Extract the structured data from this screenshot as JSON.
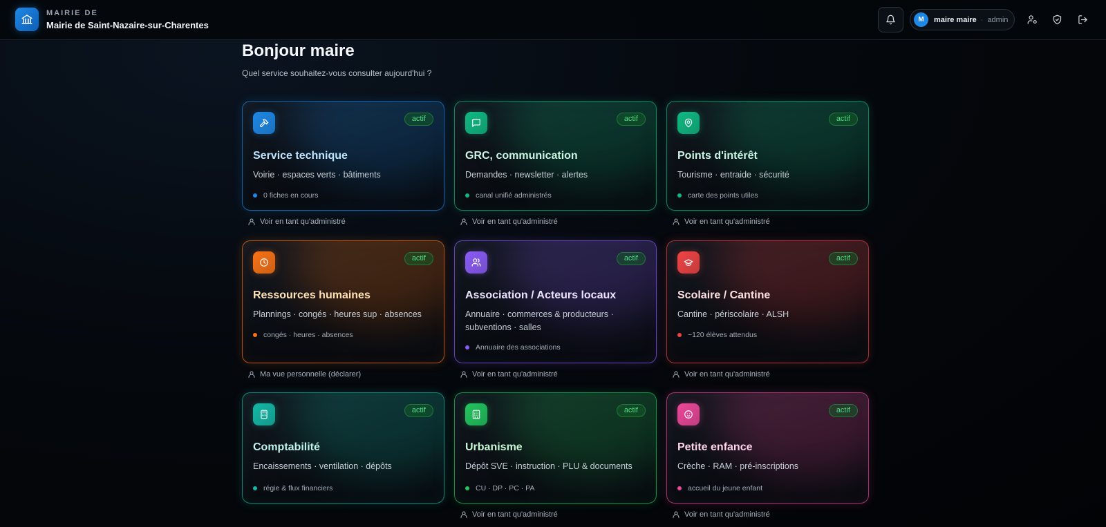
{
  "header": {
    "brand_sub": "MAIRIE DE",
    "brand_title": "Mairie de Saint-Nazaire-sur-Charentes",
    "user_initial": "M",
    "user_name": "maire maire",
    "user_separator": "·",
    "user_role": "admin"
  },
  "greeting": "Bonjour maire",
  "subtitle": "Quel service souhaitez-vous consulter aujourd'hui ?",
  "badge_label": "actif",
  "cards": [
    {
      "title": "Service technique",
      "desc": "Voirie · espaces verts · bâtiments",
      "meta": "0 fiches en cours",
      "link": "Voir en tant qu'administré",
      "color": "#1e88e5",
      "title_color": "#bfe6ff",
      "icon": "hammer-icon"
    },
    {
      "title": "GRC, communication",
      "desc": "Demandes · newsletter · alertes",
      "meta": "canal unifié administrés",
      "link": "Voir en tant qu'administré",
      "color": "#10b981",
      "title_color": "#c9f5e2",
      "icon": "chat-icon"
    },
    {
      "title": "Points d'intérêt",
      "desc": "Tourisme · entraide · sécurité",
      "meta": "carte des points utiles",
      "link": "Voir en tant qu'administré",
      "color": "#10b981",
      "title_color": "#c9f5e2",
      "icon": "map-pin-icon"
    },
    {
      "title": "Ressources humaines",
      "desc": "Plannings · congés · heures sup · absences",
      "meta": "congés · heures · absences",
      "link": "Ma vue personnelle (déclarer)",
      "color": "#f97316",
      "title_color": "#ffe1b8",
      "icon": "clock-icon"
    },
    {
      "title": "Association / Acteurs locaux",
      "desc": "Annuaire · commerces & producteurs · subventions · salles",
      "meta": "Annuaire des associations",
      "link": "Voir en tant qu'administré",
      "color": "#8b5cf6",
      "title_color": "#ece3ff",
      "icon": "users-icon"
    },
    {
      "title": "Scolaire / Cantine",
      "desc": "Cantine · périscolaire · ALSH",
      "meta": "~120 élèves attendus",
      "link": "Voir en tant qu'administré",
      "color": "#ef4444",
      "title_color": "#ffe0e0",
      "icon": "graduation-cap-icon"
    },
    {
      "title": "Comptabilité",
      "desc": "Encaissements · ventilation · dépôts",
      "meta": "régie & flux financiers",
      "link": "",
      "color": "#14b8a6",
      "title_color": "#bff3ee",
      "icon": "calculator-icon"
    },
    {
      "title": "Urbanisme",
      "desc": "Dépôt SVE · instruction · PLU & documents",
      "meta": "CU · DP · PC · PA",
      "link": "Voir en tant qu'administré",
      "color": "#22c55e",
      "title_color": "#c9f7d5",
      "icon": "building-icon"
    },
    {
      "title": "Petite enfance",
      "desc": "Crèche · RAM · pré-inscriptions",
      "meta": "accueil du jeune enfant",
      "link": "Voir en tant qu'administré",
      "color": "#ec4899",
      "title_color": "#ffd4ea",
      "icon": "baby-icon"
    }
  ]
}
